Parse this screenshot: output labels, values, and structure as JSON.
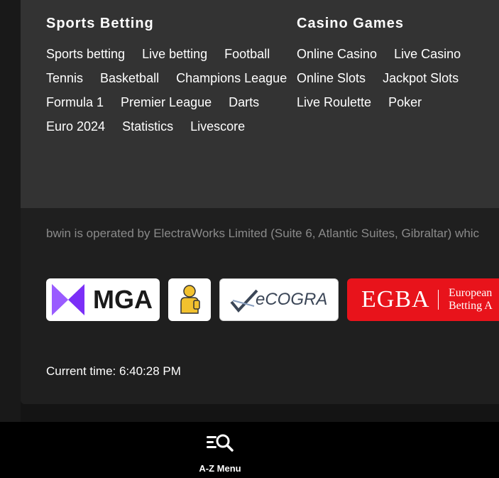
{
  "sports": {
    "title": "Sports Betting",
    "links": [
      "Sports betting",
      "Live betting",
      "Football",
      "Tennis",
      "Basketball",
      "Champions League",
      "Formula 1",
      "Premier League",
      "Darts",
      "Euro 2024",
      "Statistics",
      "Livescore"
    ]
  },
  "casino": {
    "title": "Casino Games",
    "links": [
      "Online Casino",
      "Live Casino",
      "Online Slots",
      "Jackpot Slots",
      "Live Roulette",
      "Poker"
    ]
  },
  "operator_text": "bwin is operated by ElectraWorks Limited (Suite 6, Atlantic Suites, Gibraltar) whic",
  "logos": {
    "mga": "MGA",
    "ecogra": "eCOGRA",
    "egba": "EGBA",
    "egba_sub_1": "European",
    "egba_sub_2": "Betting A"
  },
  "current_time": "Current time: 6:40:28 PM",
  "bottom_nav": {
    "az_menu_label": "A-Z Menu",
    "az_menu_icon": "menu-search-icon"
  },
  "colors": {
    "page_bg": "#141414",
    "links_bg": "#333333",
    "footer_bg": "#1f1f1f",
    "mga_purple": "#7b2ff7",
    "egba_red": "#e8131b",
    "bottom_bar": "#000000"
  }
}
